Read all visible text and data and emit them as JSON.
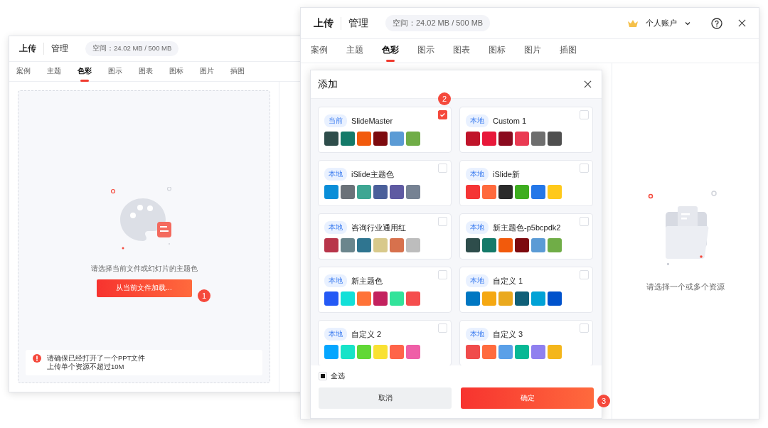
{
  "back_window": {
    "nav": [
      {
        "label": "上传",
        "selected": true
      },
      {
        "label": "管理",
        "selected": false
      }
    ],
    "storage": "空间：24.02 MB / 500 MB",
    "tabs": [
      {
        "label": "案例",
        "selected": false
      },
      {
        "label": "主题",
        "selected": false
      },
      {
        "label": "色彩",
        "selected": true
      },
      {
        "label": "图示",
        "selected": false
      },
      {
        "label": "图表",
        "selected": false
      },
      {
        "label": "图标",
        "selected": false
      },
      {
        "label": "图片",
        "selected": false
      },
      {
        "label": "插图",
        "selected": false
      }
    ],
    "prompt": "请选择当前文件或幻灯片的主题色",
    "load_button": "从当前文件加载...",
    "step_badge": "1",
    "notices": [
      "请确保已经打开了一个PPT文件",
      "上传单个资源不超过10M"
    ]
  },
  "front_window": {
    "nav": [
      {
        "label": "上传",
        "selected": true
      },
      {
        "label": "管理",
        "selected": false
      }
    ],
    "storage": "空间：24.02 MB / 500 MB",
    "account": "个人账户",
    "tabs": [
      {
        "label": "案例",
        "selected": false
      },
      {
        "label": "主题",
        "selected": false
      },
      {
        "label": "色彩",
        "selected": true
      },
      {
        "label": "图示",
        "selected": false
      },
      {
        "label": "图表",
        "selected": false
      },
      {
        "label": "图标",
        "selected": false
      },
      {
        "label": "图片",
        "selected": false
      },
      {
        "label": "插图",
        "selected": false
      }
    ],
    "empty_text": "请选择一个或多个资源",
    "dialog": {
      "title": "添加",
      "step_badge": "2",
      "themes": [
        {
          "tag": "当前",
          "name": "SlideMaster",
          "checked": true,
          "swatches": [
            {
              "color": "#2e4d4b"
            },
            {
              "color": "#147a69"
            },
            {
              "color": "#f25a0c"
            },
            {
              "color": "#7d0a0e"
            },
            {
              "color": "#5b9bd5"
            },
            {
              "color": "#70ad47"
            }
          ]
        },
        {
          "tag": "本地",
          "name": "Custom 1",
          "checked": false,
          "swatches": [
            {
              "color": "#c0142a"
            },
            {
              "color": "#e8183a"
            },
            {
              "color": "#8a0a1e"
            },
            {
              "color": "#ea3a52"
            },
            {
              "color": "#6e6e6e"
            },
            {
              "color": "#4f4f4f"
            }
          ]
        },
        {
          "tag": "本地",
          "name": "iSlide主题色",
          "checked": false,
          "swatches": [
            {
              "color": "#0a8ed8"
            },
            {
              "color": "#6b7279"
            },
            {
              "color": "#3ea693"
            },
            {
              "color": "#4a5f9a"
            },
            {
              "color": "#5f5aa2"
            },
            {
              "color": "#768293"
            }
          ]
        },
        {
          "tag": "本地",
          "name": "iSlide新",
          "checked": false,
          "swatches": [
            {
              "color": "#f53535"
            },
            {
              "color": "#ff6a3d"
            },
            {
              "color": "#2b2b2b"
            },
            {
              "color": "#3ead20"
            },
            {
              "color": "#2477e8"
            },
            {
              "color": "#ffc91a"
            }
          ]
        },
        {
          "tag": "本地",
          "name": "咨询行业通用红",
          "checked": false,
          "swatches": [
            {
              "color": "#b8354a"
            },
            {
              "color": "#6b868d"
            },
            {
              "color": "#2f7590"
            },
            {
              "color": "#d8c98b"
            },
            {
              "color": "#d7714d"
            },
            {
              "color": "#bdbdbd"
            }
          ]
        },
        {
          "tag": "本地",
          "name": "新主题色-p5bcpdk2",
          "checked": false,
          "swatches": [
            {
              "color": "#2e4d4b"
            },
            {
              "color": "#147a69"
            },
            {
              "color": "#f25a0c"
            },
            {
              "color": "#7d0a0e"
            },
            {
              "color": "#5b9bd5"
            },
            {
              "color": "#70ad47"
            }
          ]
        },
        {
          "tag": "本地",
          "name": "新主题色",
          "checked": false,
          "swatches": [
            {
              "color": "#2459f5"
            },
            {
              "color": "#12e0d8"
            },
            {
              "color": "#ff7338"
            },
            {
              "color": "#c3215e"
            },
            {
              "color": "#33e39a"
            },
            {
              "color": "#f54e4e"
            }
          ]
        },
        {
          "tag": "本地",
          "name": "自定义 1",
          "checked": false,
          "swatches": [
            {
              "color": "#0077c2"
            },
            {
              "color": "#f5a812"
            },
            {
              "color": "#eaa91e"
            },
            {
              "color": "#0f5f78"
            },
            {
              "color": "#00a2d6"
            },
            {
              "color": "#0052cc"
            }
          ]
        },
        {
          "tag": "本地",
          "name": "自定义 2",
          "checked": false,
          "swatches": [
            {
              "color": "#05a6ff"
            },
            {
              "color": "#17e3c8"
            },
            {
              "color": "#61d836"
            },
            {
              "color": "#f9e133"
            },
            {
              "color": "#ff6449"
            },
            {
              "color": "#ef5fa7"
            }
          ]
        },
        {
          "tag": "本地",
          "name": "自定义 3",
          "checked": false,
          "swatches": [
            {
              "color": "#f04b4b"
            },
            {
              "color": "#ff6b3e"
            },
            {
              "color": "#5aa0e8"
            },
            {
              "color": "#08b895"
            },
            {
              "color": "#8f80ef"
            },
            {
              "color": "#f4b61b"
            }
          ]
        }
      ],
      "select_all": {
        "label": "全选",
        "indeterminate": true
      },
      "buttons": [
        {
          "label": "取消",
          "kind": "secondary"
        },
        {
          "label": "确定",
          "kind": "primary"
        }
      ],
      "confirm_badge": "3"
    }
  }
}
